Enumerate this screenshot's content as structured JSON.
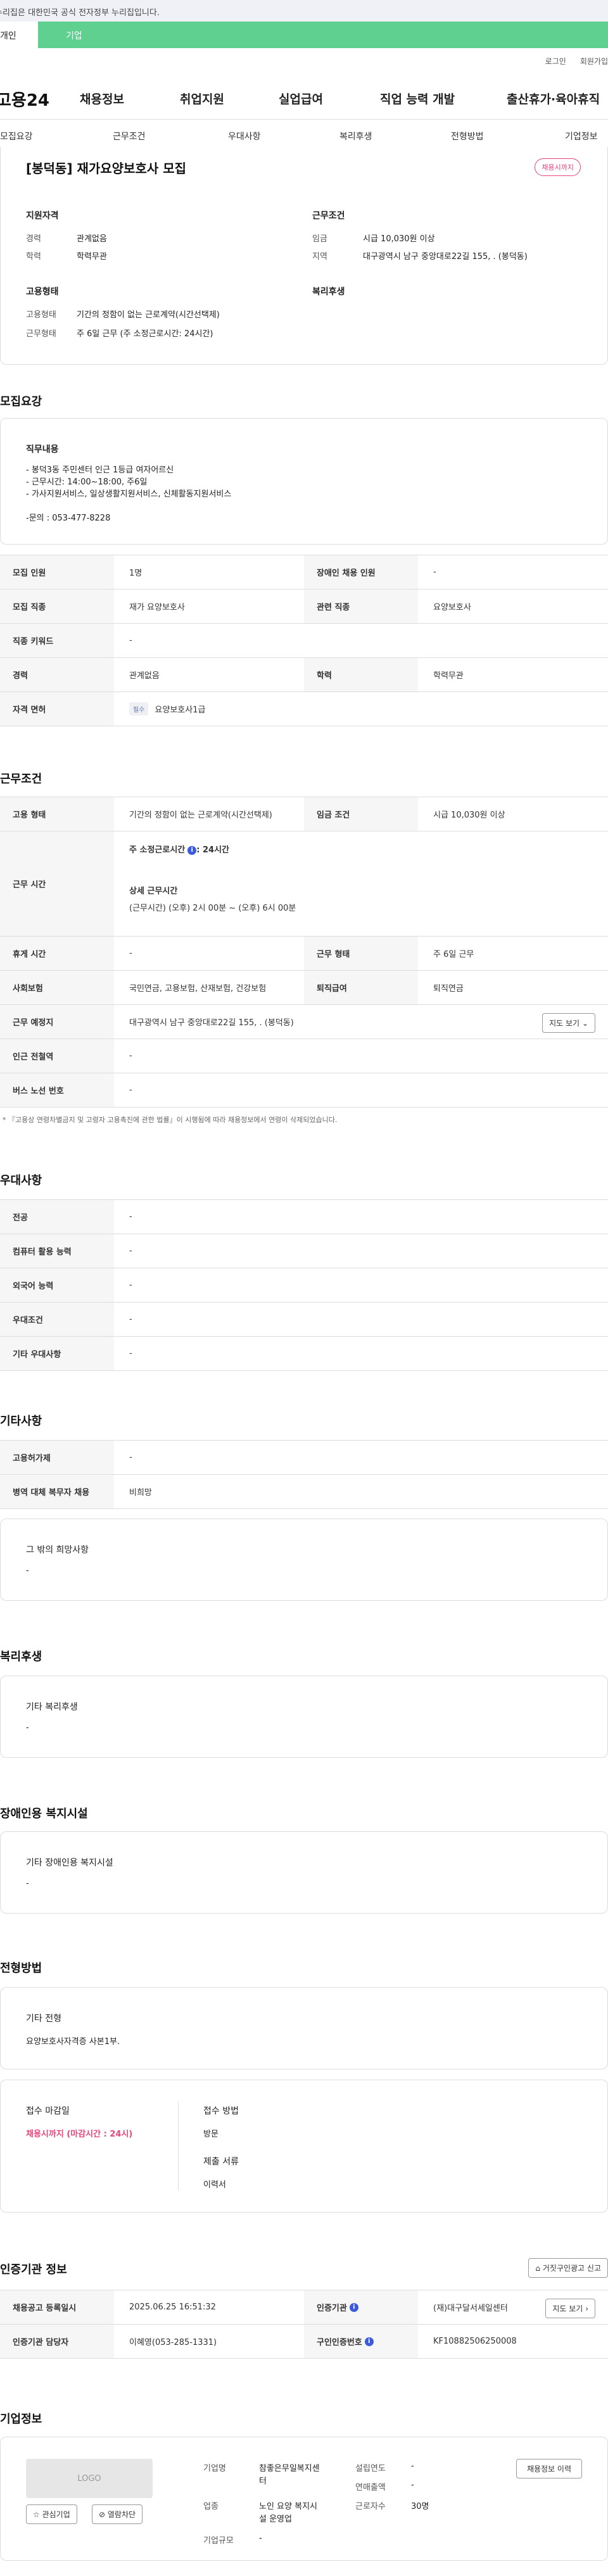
{
  "gov_bar": "이 누리집은 대한민국 공식 전자정부 누리집입니다.",
  "tabs": {
    "a": "개인",
    "b": "기업"
  },
  "util": {
    "login": "로그인",
    "join": "회원가입"
  },
  "logo": "고용24",
  "gnb": [
    "채용정보",
    "취업지원",
    "실업급여",
    "직업 능력 개발",
    "출산휴가·육아휴직"
  ],
  "subnav": [
    "모집요강",
    "근무조건",
    "우대사항",
    "복리후생",
    "전형방법",
    "기업정보"
  ],
  "summary": {
    "title": "[봉덕동] 재가요양보호사 모집",
    "badge": "채용시까지",
    "qual_title": "지원자격",
    "qual": [
      {
        "k": "경력",
        "v": "관계없음"
      },
      {
        "k": "학력",
        "v": "학력무관"
      }
    ],
    "cond_title": "근무조건",
    "cond": [
      {
        "k": "임금",
        "v": "시급 10,030원 이상"
      },
      {
        "k": "지역",
        "v": "대구광역시 남구 중앙대로22길 155, . (봉덕동)"
      }
    ],
    "emp_title": "고용형태",
    "emp": [
      {
        "k": "고용형태",
        "v": "기간의 정함이 없는 근로계약(시간선택제)"
      },
      {
        "k": "근무형태",
        "v": "주 6일 근무 (주 소정근로시간: 24시간)"
      }
    ],
    "welfare_title": "복리후생"
  },
  "recruit": {
    "title": "모집요강",
    "duty_title": "직무내용",
    "duty_lines": [
      "- 봉덕3동 주민센터 인근 1등급 여자어르신",
      "- 근무시간: 14:00~18:00, 주6일",
      "- 가사지원서비스, 일상생활지원서비스, 신체활동지원서비스",
      "",
      "-문의 : 053-477-8228"
    ],
    "rows": [
      {
        "k1": "모집 인원",
        "v1": "1명",
        "k2": "장애인 채용 인원",
        "v2": "-"
      },
      {
        "k1": "모집 직종",
        "v1": "재가 요양보호사",
        "k2": "관련 직종",
        "v2": "요양보호사"
      },
      {
        "k1": "직종 키워드",
        "v1": "-"
      },
      {
        "k1": "경력",
        "v1": "관계없음",
        "k2": "학력",
        "v2": "학력무관"
      },
      {
        "k1": "자격 면허",
        "tag": "필수",
        "v1": "요양보호사1급"
      }
    ]
  },
  "work": {
    "title": "근무조건",
    "emp_k": "고용 형태",
    "emp_v": "기간의 정함이 없는 근로계약(시간선택제)",
    "wage_k": "임금 조건",
    "wage_v": "시급 10,030원 이상",
    "time_k": "근무 시간",
    "time_l1": "주 소정근로시간",
    "time_l1b": ": 24시간",
    "time_l2": "상세 근무시간",
    "time_l3": "(근무시간) (오후) 2시 00분 ~ (오후) 6시 00분",
    "rest_k": "휴게 시간",
    "rest_v": "-",
    "form_k": "근무 형태",
    "form_v": "주 6일 근무",
    "ins_k": "사회보험",
    "ins_v": "국민연금, 고용보험, 산재보험, 건강보험",
    "ret_k": "퇴직급여",
    "ret_v": "퇴직연금",
    "place_k": "근무 예정지",
    "place_v": "대구광역시 남구 중앙대로22길 155, . (봉덕동)",
    "map_btn": "지도 보기",
    "subway_k": "인근 전철역",
    "subway_v": "-",
    "bus_k": "버스 노선 번호",
    "bus_v": "-",
    "note": "* 『고용상 연령차별금지 및 고령자 고용촉진에 관한 법률』이 시행됨에 따라 채용정보에서 연령이 삭제되었습니다."
  },
  "pref": {
    "title": "우대사항",
    "rows": [
      {
        "k": "전공",
        "v": "-"
      },
      {
        "k": "컴퓨터 활용 능력",
        "v": "-"
      },
      {
        "k": "외국어 능력",
        "v": "-"
      },
      {
        "k": "우대조건",
        "v": "-"
      },
      {
        "k": "기타 우대사항",
        "v": "-"
      }
    ]
  },
  "etc": {
    "title": "기타사항",
    "rows": [
      {
        "k": "고용허가제",
        "v": "-"
      },
      {
        "k": "병역 대체 복무자 채용",
        "v": "비희망"
      }
    ],
    "box_title": "그 밖의 희망사항",
    "box_v": "-"
  },
  "welfare": {
    "title": "복리후생",
    "box_title": "기타 복리후생",
    "box_v": "-"
  },
  "disab": {
    "title": "장애인용 복지시설",
    "box_title": "기타 장애인용 복지시설",
    "box_v": "-"
  },
  "select": {
    "title": "전형방법",
    "box_title": "기타 전형",
    "box_v": "요양보호사자격증 사본1부.",
    "deadline_t": "접수 마감일",
    "deadline_v": "채용시까지 (마감시간 : 24시)",
    "method_t": "접수 방법",
    "method_v": "방문",
    "docs_t": "제출 서류",
    "docs_v": "이력서"
  },
  "cert": {
    "title": "인증기관 정보",
    "report_btn": "거짓구인광고 신고",
    "reg_k": "채용공고 등록일시",
    "reg_v": "2025.06.25 16:51:32",
    "org_k": "인증기관",
    "org_v": "(재)대구달서세일센터",
    "map_btn": "지도 보기",
    "mgr_k": "인증기관 담당자",
    "mgr_v": "이혜영(053-285-1331)",
    "no_k": "구인인증번호",
    "no_v": "KF10882506250008"
  },
  "company": {
    "title": "기업정보",
    "logo": "LOGO",
    "fav_btn": "관심기업",
    "block_btn": "열람차단",
    "name_k": "기업명",
    "name_v1": "참좋은무일복지센",
    "name_v2": "터",
    "est_k": "설립연도",
    "est_v": "-",
    "biz_k": "업종",
    "biz_v1": "노인 요양 복지시",
    "biz_v2": "설 운영업",
    "sales_k": "연매출액",
    "sales_v": "-",
    "emp_k": "근로자수",
    "emp_v": "30명",
    "size_k": "기업규모",
    "size_v": "-",
    "history_btn": "채용정보 이력"
  }
}
